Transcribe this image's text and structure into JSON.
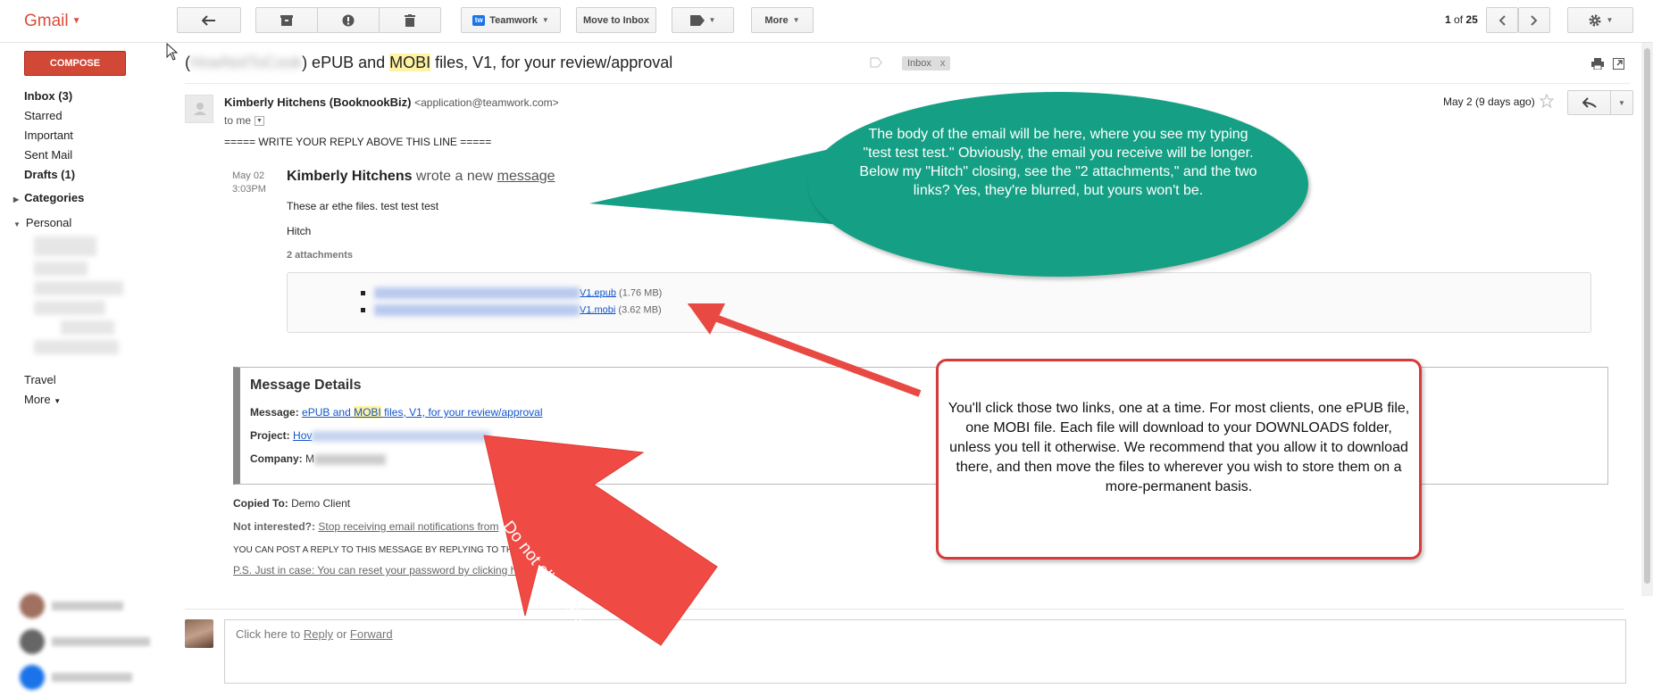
{
  "app": {
    "logo": "Gmail"
  },
  "toolbar": {
    "teamwork_label": "Teamwork",
    "move_inbox_label": "Move to Inbox",
    "more_label": "More"
  },
  "pager": {
    "current": "1",
    "of": "of",
    "total": "25"
  },
  "sidebar": {
    "compose": "COMPOSE",
    "items": [
      {
        "label": "Inbox (3)",
        "bold": true
      },
      {
        "label": "Starred",
        "bold": false
      },
      {
        "label": "Important",
        "bold": false
      },
      {
        "label": "Sent Mail",
        "bold": false
      },
      {
        "label": "Drafts (1)",
        "bold": true
      }
    ],
    "categories": "Categories",
    "personal": "Personal",
    "travel": "Travel",
    "more": "More"
  },
  "thread": {
    "subject_prefix": "(",
    "subject_middle": ") ePUB and ",
    "subject_highlight": "MOBI",
    "subject_rest": " files, V1, for your review/approval",
    "label_chip": "Inbox",
    "label_chip_x": "x"
  },
  "message": {
    "sender_name": "Kimberly Hitchens (BooknookBiz)",
    "sender_addr": "<application@teamwork.com>",
    "to": "to me",
    "date": "May 2 (9 days ago)",
    "reply_divider": "===== WRITE YOUR REPLY ABOVE THIS LINE =====",
    "time_date": "May 02",
    "time_clock": "3:03PM",
    "wrote_name": "Kimberly Hitchens",
    "wrote_mid": " wrote a new ",
    "wrote_link": "message",
    "body_line1": "These ar ethe files. test test test",
    "body_line2": "Hitch",
    "attachments_head": "2 attachments",
    "attachments": [
      {
        "link_suffix": "V1.epub",
        "size": "(1.76 MB)"
      },
      {
        "link_suffix": "V1.mobi",
        "size": "(3.62 MB)"
      }
    ]
  },
  "details": {
    "title": "Message Details",
    "message_label": "Message:",
    "message_link_pre": "ePUB and ",
    "message_link_hl": "MOBI",
    "message_link_post": " files, V1, for your review/approval",
    "project_label": "Project:",
    "project_link": "Hov",
    "company_label": "Company:",
    "company_value": "M"
  },
  "footer": {
    "copied_label": "Copied To:",
    "copied_value": "Demo Client",
    "notint_label": "Not interested?:",
    "notint_link": "Stop receiving email notifications from",
    "reply_note": "YOU CAN POST A REPLY TO THIS MESSAGE BY REPLYING TO TH",
    "ps_note": "P.S. Just in case: You can reset your password by clicking he"
  },
  "reply": {
    "pre": "Click here to ",
    "reply": "Reply",
    "mid": " or ",
    "forward": "Forward"
  },
  "annotations": {
    "green_bubble": "The body of the email will be here, where you see my typing \"test test test.\"  Obviously, the email you receive will be longer.\nBelow my \"Hitch\" closing, see the \"2 attachments,\" and the two links?  Yes, they're blurred, but yours won't be.",
    "note_box": "You'll click those two links, one at a time.  For most clients, one ePUB file, one MOBI file. Each file will download to your DOWNLOADS folder, unless you tell it otherwise.  We recommend that you allow it to download there, and then move the files to wherever you wish to store them on a more-permanent basis.",
    "arrow_text": "Do not click these."
  },
  "colors": {
    "brand_red": "#dd4b39",
    "compose_red": "#d14836",
    "callout_green": "#15a085",
    "arrow_red": "#f04a45",
    "link_blue": "#1155cc"
  }
}
